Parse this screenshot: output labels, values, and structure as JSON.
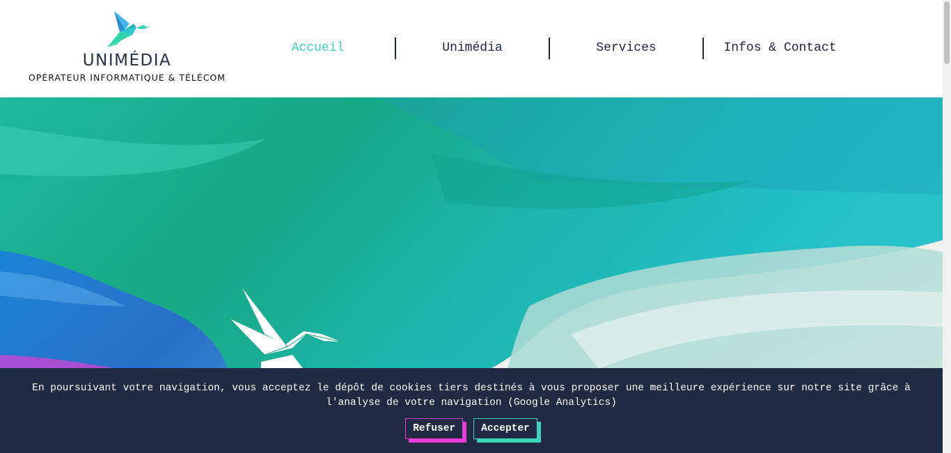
{
  "header": {
    "logo": {
      "name": "UNIMÉDIA",
      "tagline": "OPÉRATEUR INFORMATIQUE & TÉLÉCOM",
      "icon": "hummingbird-icon"
    },
    "nav": [
      {
        "label": "Accueil",
        "active": true
      },
      {
        "label": "Unimédia",
        "active": false
      },
      {
        "label": "Services",
        "active": false
      },
      {
        "label": "Infos & Contact",
        "active": false
      }
    ]
  },
  "hero": {
    "image": "watercolor-brushstrokes-banner",
    "icon": "origami-bird-icon"
  },
  "cookie_banner": {
    "text": "En poursuivant votre navigation, vous acceptez le dépôt de cookies tiers destinés à vous proposer une meilleure expérience sur notre site grâce à l'analyse de votre navigation (Google Analytics)",
    "refuse_label": "Refuser",
    "accept_label": "Accepter"
  },
  "colors": {
    "accent_teal": "#3ad2b4",
    "accent_magenta": "#e83ad5",
    "navy": "#202b43",
    "nav_text": "#1d2740"
  }
}
